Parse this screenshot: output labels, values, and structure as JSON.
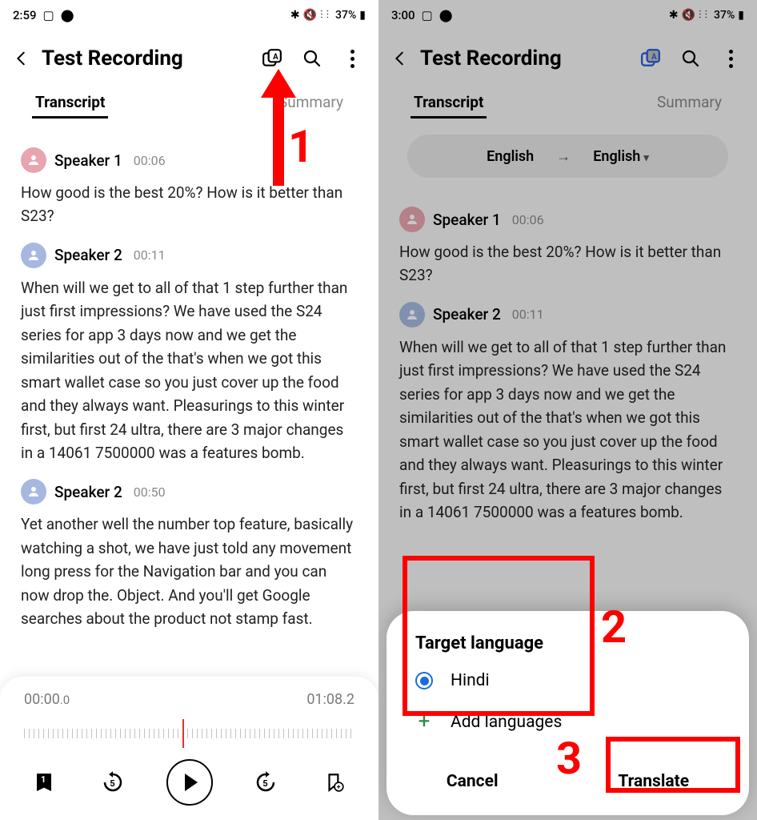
{
  "status": {
    "time_left": "2:59",
    "time_right": "3:00",
    "battery_pct": "37%"
  },
  "header": {
    "title": "Test Recording"
  },
  "tabs": {
    "transcript": "Transcript",
    "summary": "Summary"
  },
  "lang": {
    "from": "English",
    "to": "English"
  },
  "messages": [
    {
      "speaker": "Speaker 1",
      "time": "00:06",
      "text": "How good is the best 20%? How is it better than S23?"
    },
    {
      "speaker": "Speaker 2",
      "time": "00:11",
      "text": "When will we get to all of that 1 step further than just first impressions? We have used the S24 series for app 3 days now and we get the similarities out of the that's when we got this smart wallet case so you just cover up the food and they always want. Pleasurings to this winter first, but first 24 ultra, there are 3 major changes in a 14061 7500000 was a features bomb."
    },
    {
      "speaker": "Speaker 2",
      "time": "00:50",
      "text": "Yet another well the number top feature, basically watching a shot, we have just told any movement long press for the Navigation bar and you can now drop the. Object. And you'll get Google searches about the product not stamp fast."
    }
  ],
  "player": {
    "current": "00:00",
    "current_frac": ".0",
    "total": "01:08.2",
    "bookmark_count": "1"
  },
  "sheet": {
    "title": "Target language",
    "option1": "Hindi",
    "add": "Add languages",
    "cancel": "Cancel",
    "translate": "Translate"
  },
  "annotations": {
    "n1": "1",
    "n2": "2",
    "n3": "3"
  }
}
